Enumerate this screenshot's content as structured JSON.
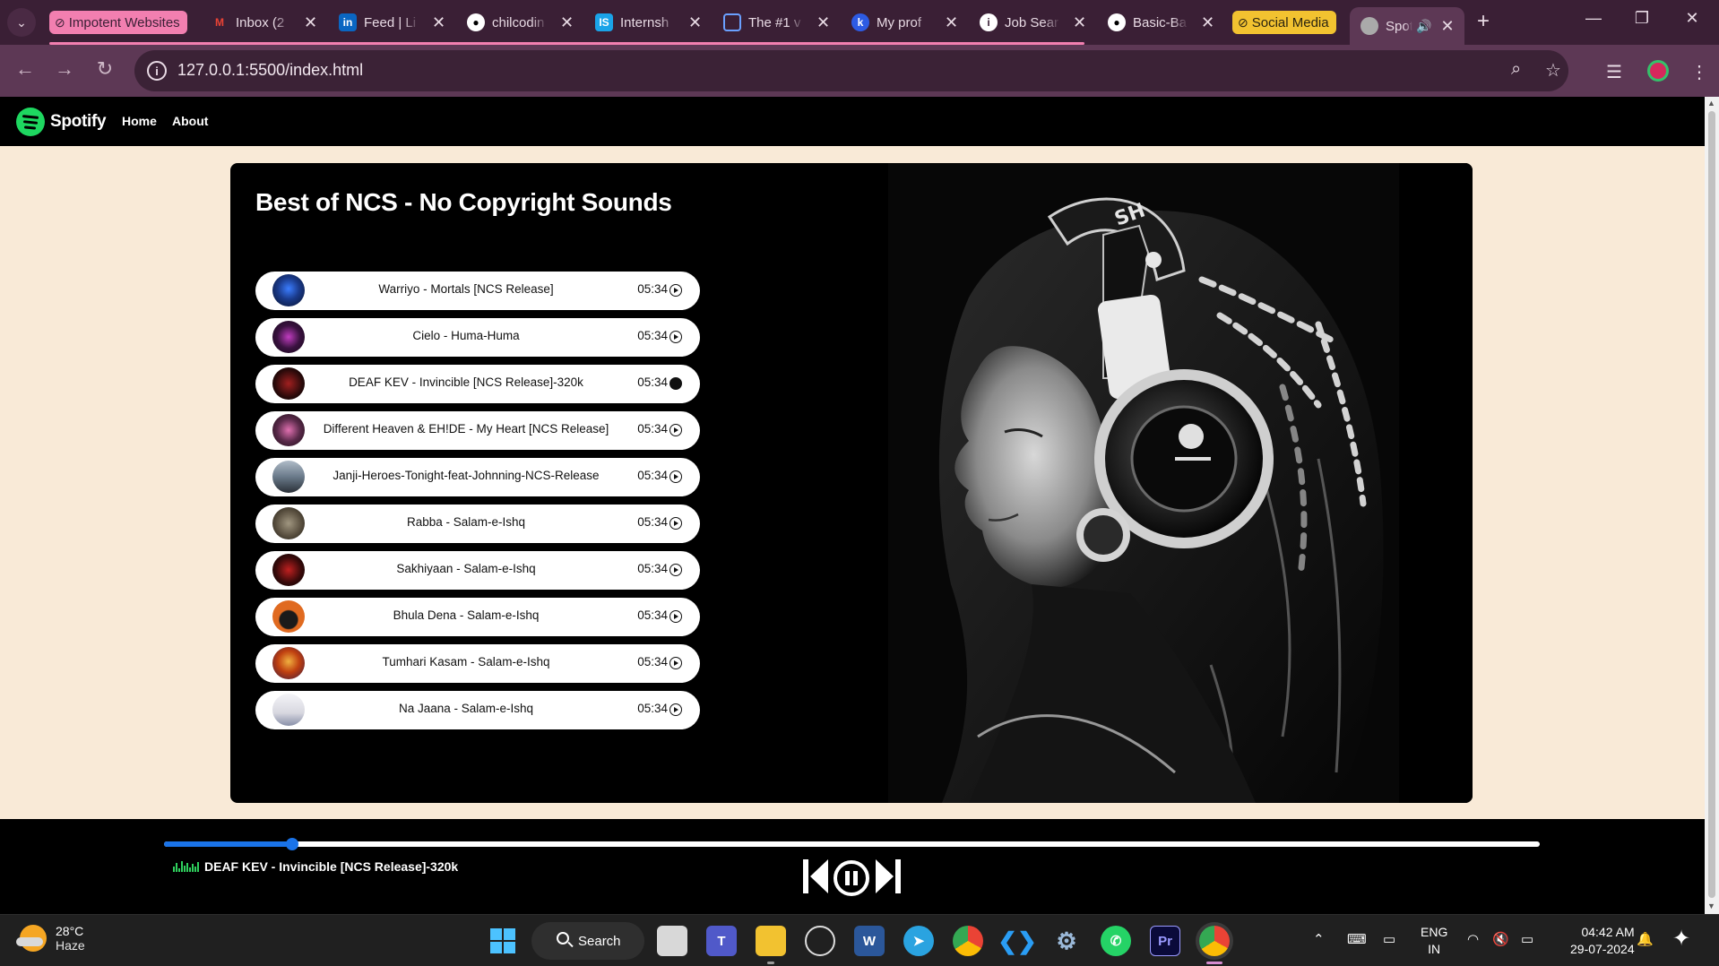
{
  "browser": {
    "tab_groups": [
      {
        "label": "Impotent Websites",
        "color": "#f27fb0",
        "text_color": "#3a1f35"
      },
      {
        "label": "Social Media",
        "color": "#f2c230",
        "text_color": "#2a2310"
      }
    ],
    "tabs": [
      {
        "title": "Inbox (2",
        "icon": "gmail-icon"
      },
      {
        "title": "Feed | Li",
        "icon": "linkedin-icon"
      },
      {
        "title": "chilcodin",
        "icon": "github-icon"
      },
      {
        "title": "Internsh",
        "icon": "internshala-icon"
      },
      {
        "title": "The #1 v",
        "icon": "document-icon"
      },
      {
        "title": "My prof",
        "icon": "profile-site-icon"
      },
      {
        "title": "Job Sear",
        "icon": "info-site-icon"
      },
      {
        "title": "Basic-Ba",
        "icon": "github-icon"
      },
      {
        "title": "Spot",
        "icon": "globe-icon",
        "active": true,
        "audio": true
      }
    ],
    "url": "127.0.0.1:5500/index.html"
  },
  "site": {
    "brand": "Spotify",
    "nav": [
      "Home",
      "About"
    ],
    "playlist_title": "Best of NCS - No Copyright Sounds",
    "songs": [
      {
        "name": "Warriyo - Mortals [NCS Release]",
        "duration": "05:34",
        "cover": "#1a3a8a"
      },
      {
        "name": "Cielo - Huma-Huma",
        "duration": "05:34",
        "cover": "#3a1240"
      },
      {
        "name": "DEAF KEV - Invincible [NCS Release]-320k",
        "duration": "05:34",
        "cover": "#2a0a0a",
        "playing": true
      },
      {
        "name": "Different Heaven & EH!DE - My Heart [NCS Release]",
        "duration": "05:34",
        "cover": "#5a2a4a"
      },
      {
        "name": "Janji-Heroes-Tonight-feat-Johnning-NCS-Release",
        "duration": "05:34",
        "cover": "#6a7a8a"
      },
      {
        "name": "Rabba - Salam-e-Ishq",
        "duration": "05:34",
        "cover": "#5a5040"
      },
      {
        "name": "Sakhiyaan - Salam-e-Ishq",
        "duration": "05:34",
        "cover": "#3a0a0a"
      },
      {
        "name": "Bhula Dena - Salam-e-Ishq",
        "duration": "05:34",
        "cover": "#e06a20"
      },
      {
        "name": "Tumhari Kasam - Salam-e-Ishq",
        "duration": "05:34",
        "cover": "#c04010"
      },
      {
        "name": "Na Jaana - Salam-e-Ishq",
        "duration": "05:34",
        "cover": "#d8d8e0"
      }
    ],
    "player": {
      "now_playing": "DEAF KEV - Invincible [NCS Release]-320k",
      "progress": 0.093,
      "accent": "#1a73e8"
    }
  },
  "taskbar": {
    "weather_temp": "28°C",
    "weather_desc": "Haze",
    "search_label": "Search",
    "lang_top": "ENG",
    "lang_bottom": "IN",
    "time": "04:42 AM",
    "date": "29-07-2024"
  }
}
